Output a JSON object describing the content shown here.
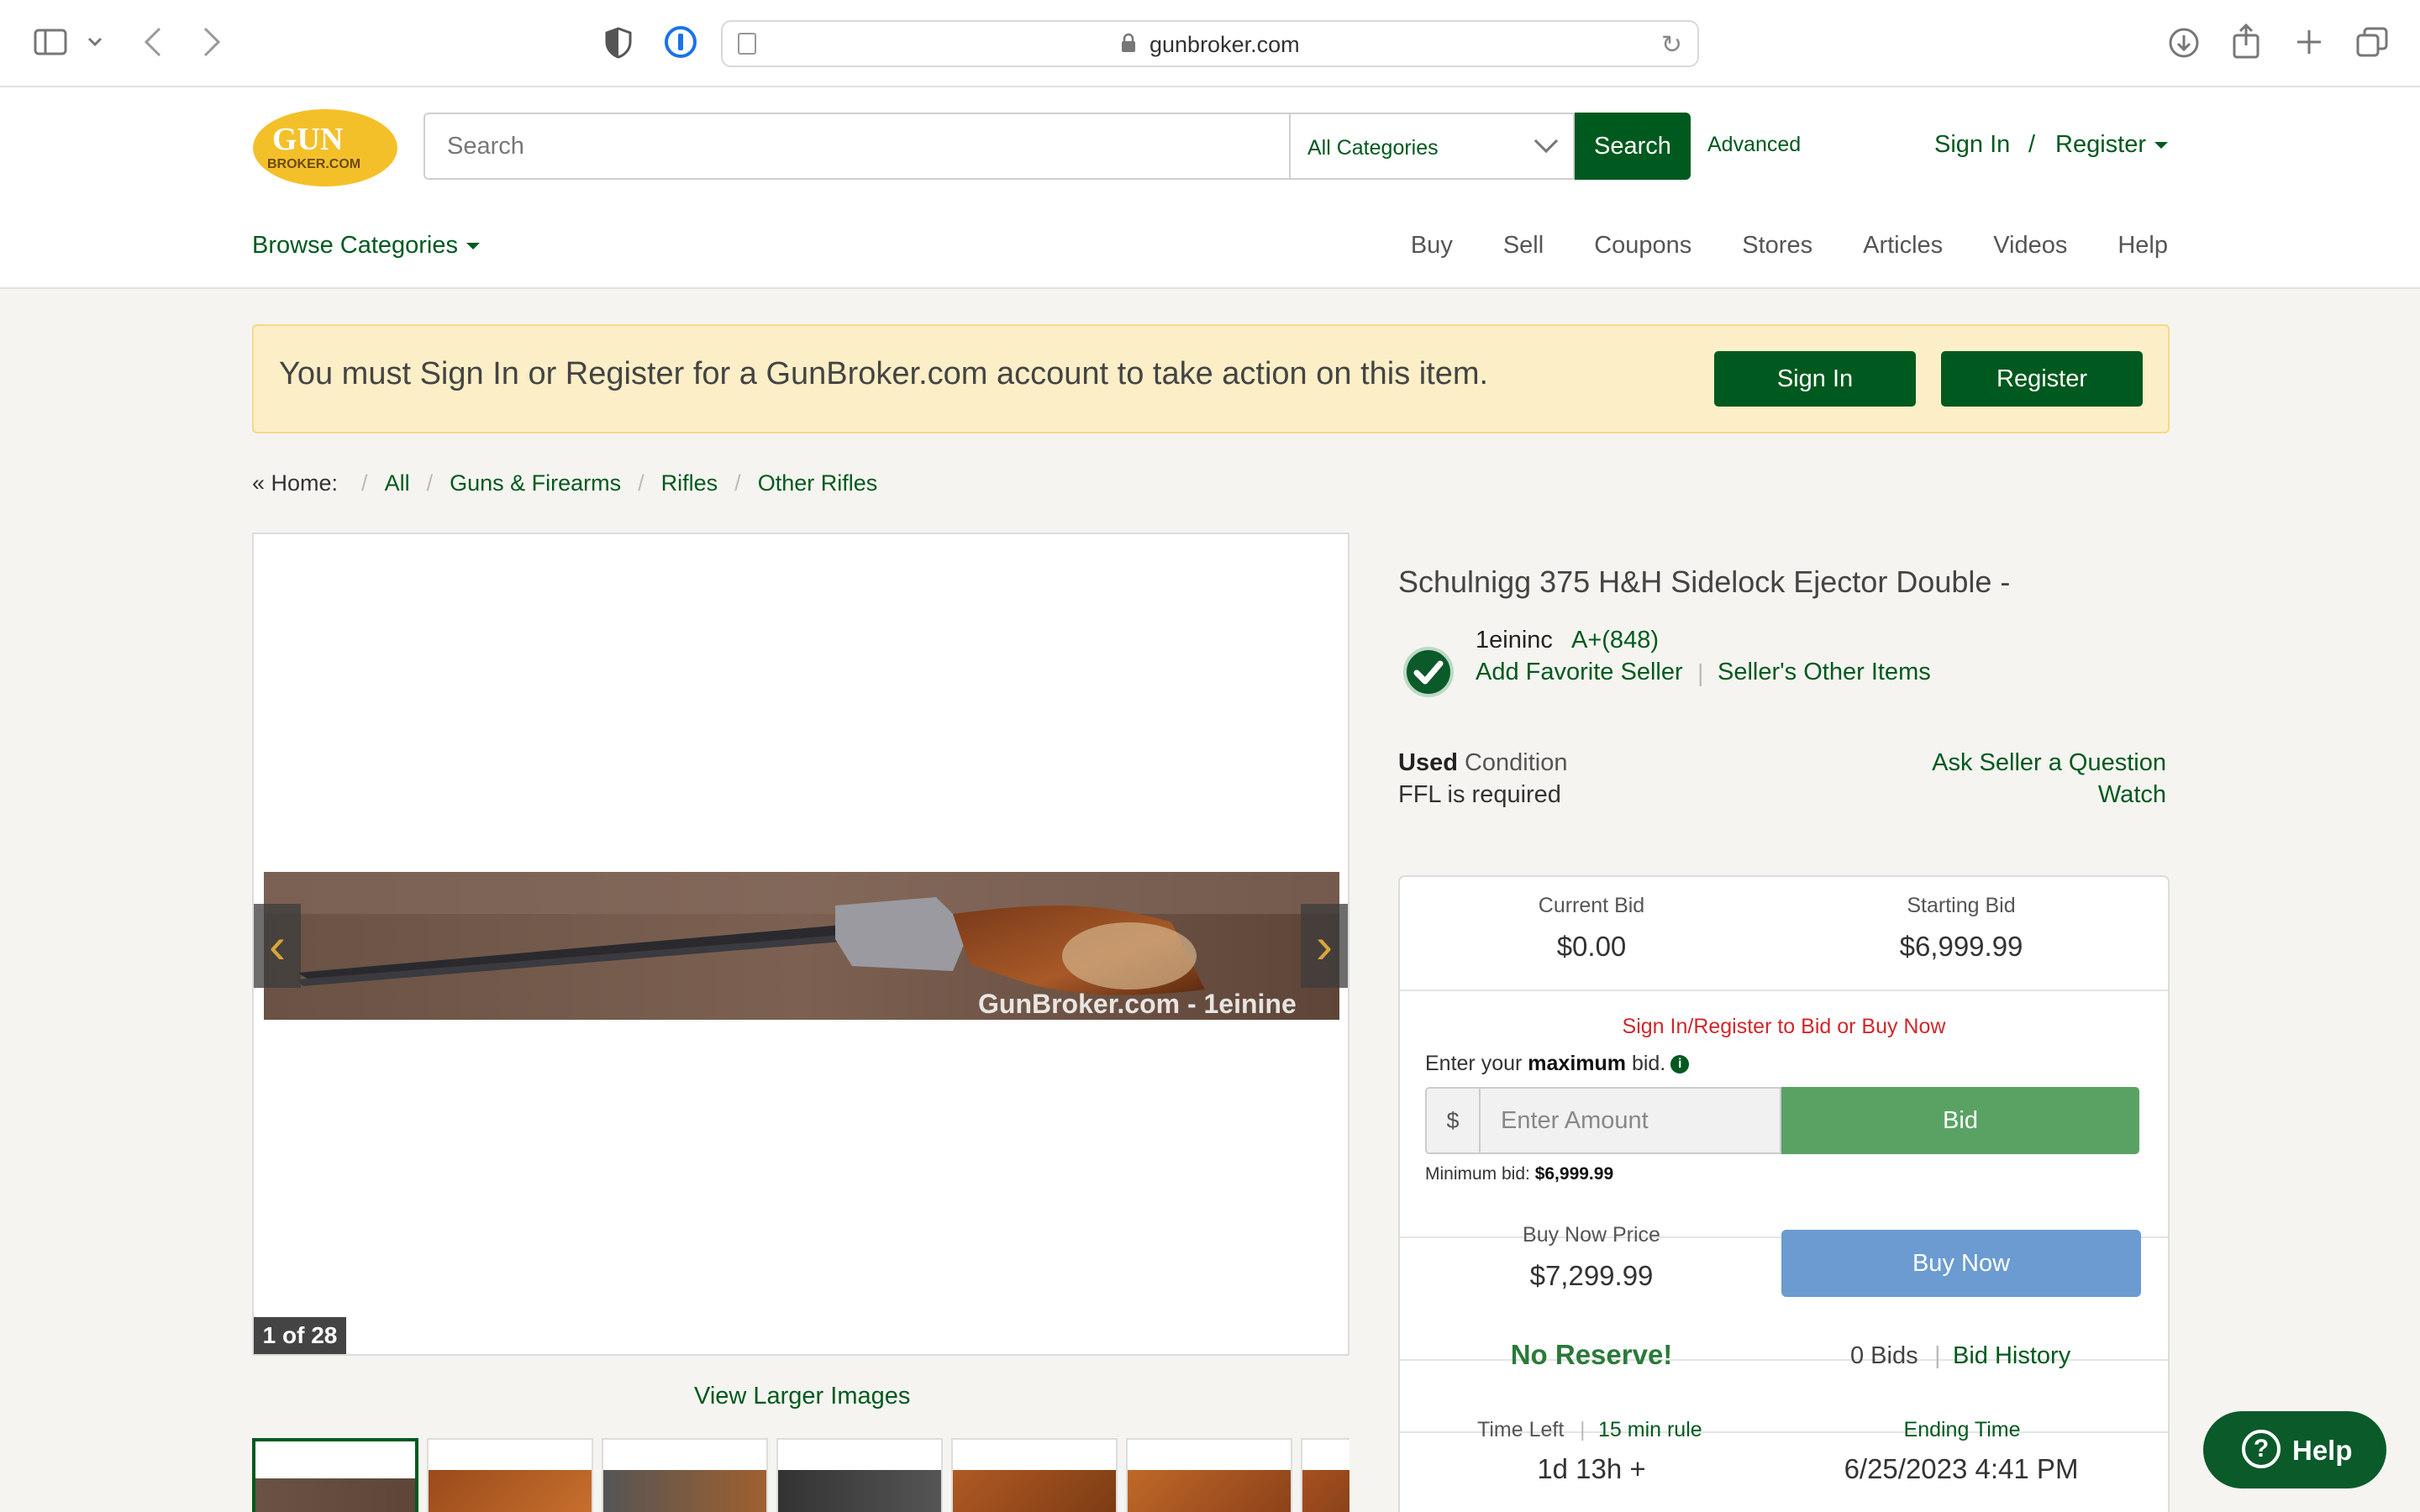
{
  "browser": {
    "url": "gunbroker.com"
  },
  "header": {
    "search_placeholder": "Search",
    "category_selected": "All Categories",
    "search_label": "Search",
    "advanced_label": "Advanced",
    "sign_in_label": "Sign In",
    "slash": "/",
    "register_label": "Register",
    "browse_label": "Browse Categories",
    "nav": [
      "Buy",
      "Sell",
      "Coupons",
      "Stores",
      "Articles",
      "Videos",
      "Help"
    ]
  },
  "alert": {
    "message": "You must Sign In or Register for a GunBroker.com account to take action on this item.",
    "sign_in_label": "Sign In",
    "register_label": "Register"
  },
  "breadcrumb": {
    "home": "« Home:",
    "items": [
      "All",
      "Guns & Firearms",
      "Rifles",
      "Other Rifles"
    ]
  },
  "gallery": {
    "watermark": "GunBroker.com - 1einine",
    "counter": "1 of 28",
    "view_larger": "View Larger Images"
  },
  "item": {
    "title": "Schulnigg 375 H&H Sidelock Ejector Double -",
    "seller_name": "1eininc",
    "seller_rating": "A+(848)",
    "add_favorite": "Add Favorite Seller",
    "pipe": "|",
    "other_items": "Seller's Other Items",
    "condition_bold": "Used",
    "condition_label": " Condition",
    "ffl": "FFL is required",
    "ask_seller": "Ask Seller a Question",
    "watch": "Watch"
  },
  "bidding": {
    "current_bid_label": "Current Bid",
    "current_bid": "$0.00",
    "starting_bid_label": "Starting Bid",
    "starting_bid": "$6,999.99",
    "warning": "Sign In/Register to Bid or Buy Now",
    "enter_prefix": "Enter your ",
    "enter_bold": "maximum",
    "enter_suffix": " bid.",
    "currency": "$",
    "amount_placeholder": "Enter Amount",
    "bid_label": "Bid",
    "min_bid_label": "Minimum bid: ",
    "min_bid": "$6,999.99",
    "buy_now_price_label": "Buy Now Price",
    "buy_now_price": "$7,299.99",
    "buy_now_label": "Buy Now",
    "no_reserve": "No Reserve!",
    "bids_count": "0 Bids",
    "pipe": "|",
    "bid_history": "Bid History",
    "time_left_label": "Time Left",
    "rule_label": "15 min rule",
    "ending_label": "Ending Time",
    "time_left": "1d 13h +",
    "ending_time": "6/25/2023 4:41 PM"
  },
  "help_widget": {
    "label": "Help"
  },
  "colors": {
    "brand_green": "#00591e",
    "bid_green": "#5aa264",
    "buy_blue": "#6b9bd1",
    "alert_bg": "#fcefc7",
    "warning_red": "#d0272b",
    "logo_yellow": "#f4c02a"
  }
}
